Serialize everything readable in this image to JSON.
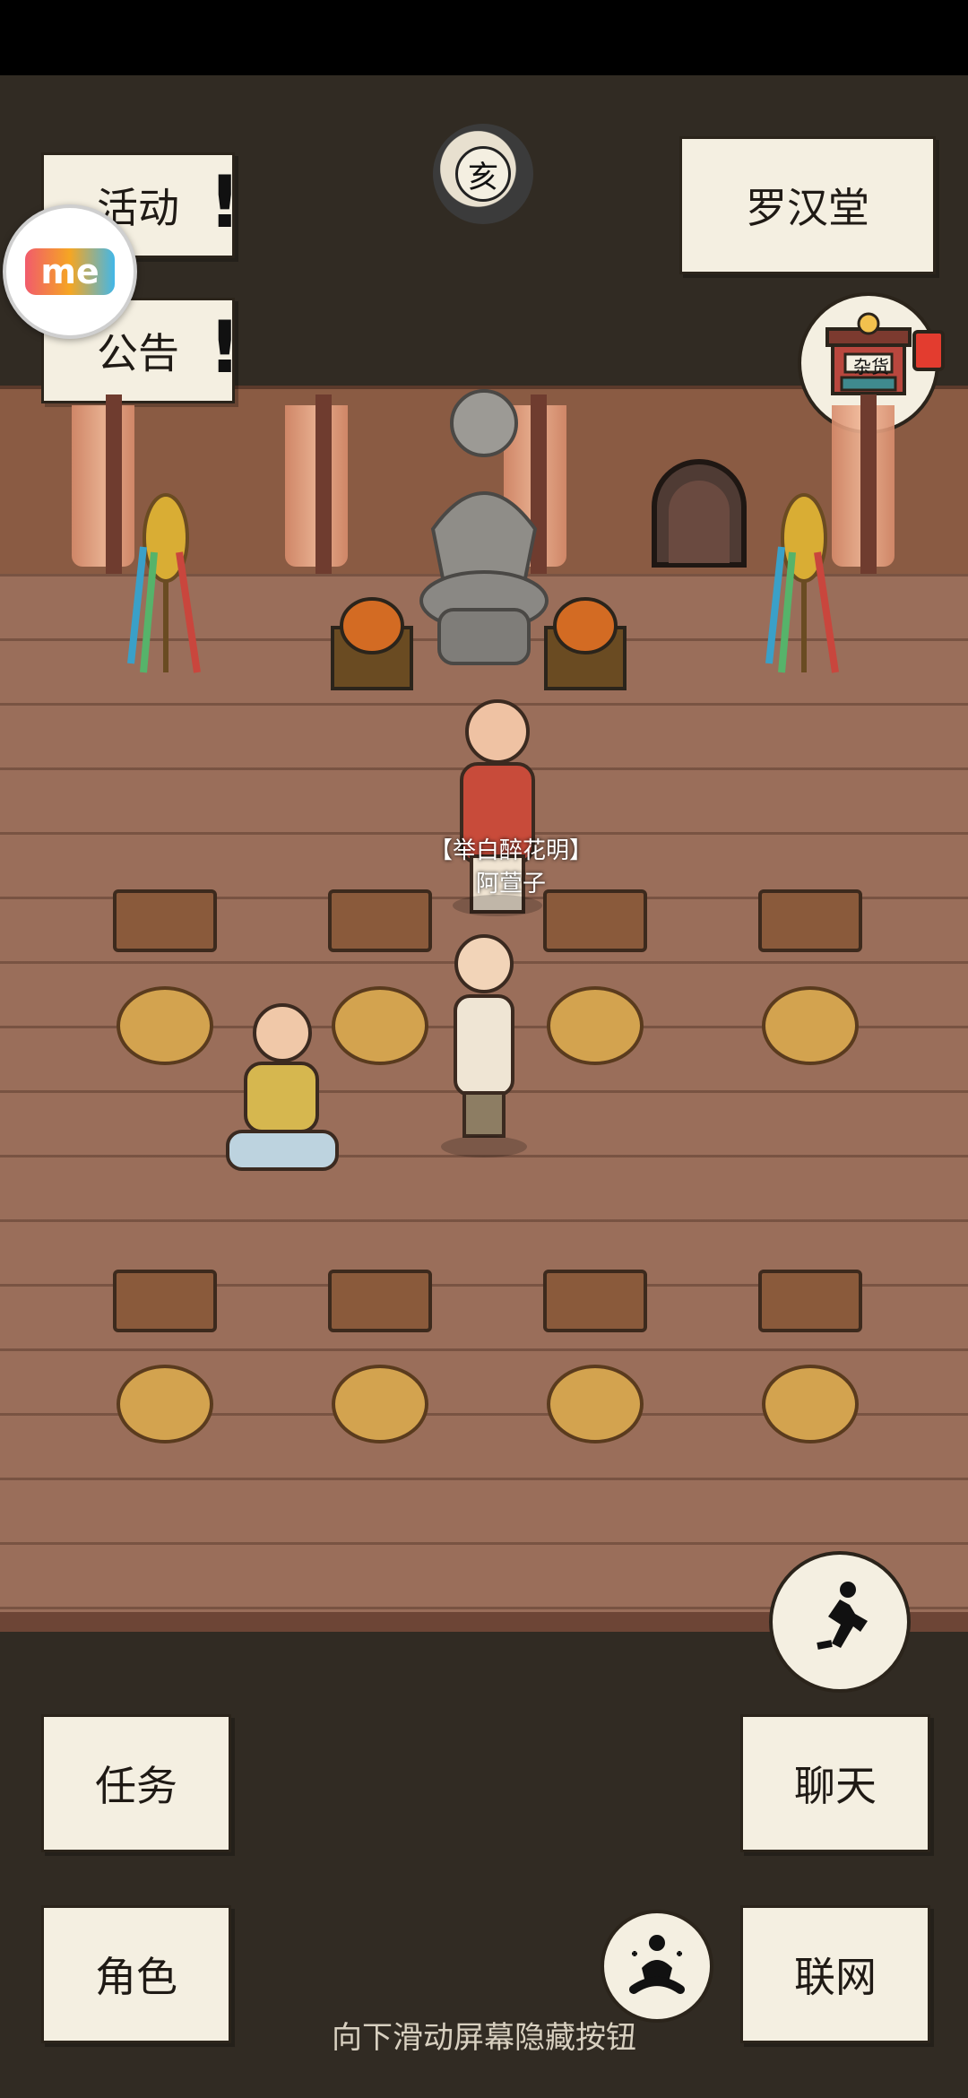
{
  "top_left": {
    "activities_label": "活动",
    "announcement_label": "公告",
    "app_badge_text": "me"
  },
  "top_center": {
    "time_badge_text": "亥"
  },
  "top_right": {
    "location_label": "罗汉堂",
    "shop_sign_text": "杂货"
  },
  "npc": {
    "title": "【举白醉花明】",
    "name": "阿萱子"
  },
  "bottom": {
    "quest_label": "任务",
    "role_label": "角色",
    "chat_label": "聊天",
    "network_label": "联网",
    "hint_text": "向下滑动屏幕隐藏按钮"
  },
  "icons": {
    "run_icon": "running-man-icon",
    "meditate_icon": "meditation-icon",
    "shop_icon": "shop-icon",
    "alert_icon": "exclamation-icon"
  },
  "colors": {
    "paper": "#f4efe1",
    "dark_panel": "#312b23",
    "floor": "#9a6e5a"
  }
}
